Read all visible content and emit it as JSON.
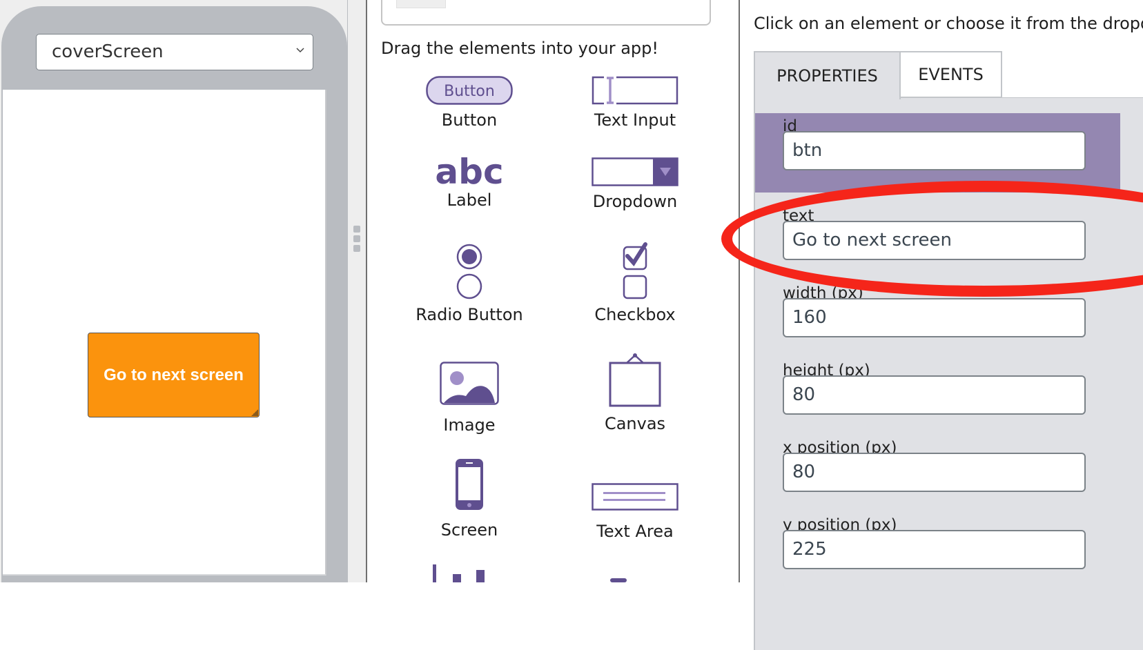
{
  "preview": {
    "screen_selector_value": "coverScreen",
    "app_button_text": "Go to next screen",
    "app_button_color": "#fb930d"
  },
  "toolbox": {
    "theme_name": "Default",
    "drag_hint": "Drag the elements into your app!",
    "button_icon_text": "Button",
    "label_icon_text": "abc",
    "items": [
      {
        "label": "Button"
      },
      {
        "label": "Text Input"
      },
      {
        "label": "Label"
      },
      {
        "label": "Dropdown"
      },
      {
        "label": "Radio Button"
      },
      {
        "label": "Checkbox"
      },
      {
        "label": "Image"
      },
      {
        "label": "Canvas"
      },
      {
        "label": "Screen"
      },
      {
        "label": "Text Area"
      }
    ],
    "accent_color": "#5f4f8f"
  },
  "properties": {
    "hint": "Click on an element or choose it from the dropdown",
    "tabs": [
      {
        "label": "PROPERTIES",
        "active": true
      },
      {
        "label": "EVENTS",
        "active": false
      }
    ],
    "fields": [
      {
        "label": "id",
        "value": "btn"
      },
      {
        "label": "text",
        "value": "Go to next screen"
      },
      {
        "label": "width (px)",
        "value": "160"
      },
      {
        "label": "height (px)",
        "value": "80"
      },
      {
        "label": "x position (px)",
        "value": "80"
      },
      {
        "label": "y position (px)",
        "value": "225"
      }
    ],
    "highlight_color": "#9487b1",
    "annotation_color": "#f5251a"
  }
}
